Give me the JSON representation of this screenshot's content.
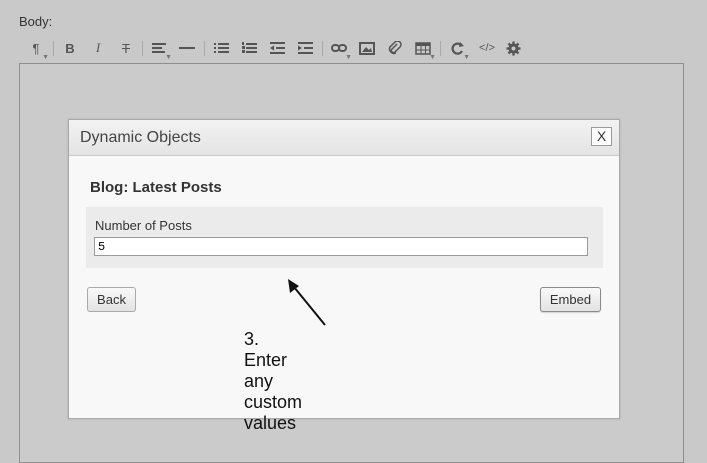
{
  "editor": {
    "body_label": "Body:"
  },
  "toolbar": {
    "paragraph": "¶",
    "bold": "B",
    "italic": "I",
    "strikethrough": "T",
    "source_code": "</>"
  },
  "dialog": {
    "title": "Dynamic Objects",
    "close_label": "X",
    "section_title": "Blog: Latest Posts",
    "field_label": "Number of Posts",
    "field_value": "5",
    "back_label": "Back",
    "embed_label": "Embed"
  },
  "annotation": {
    "text": "3. Enter any custom values"
  }
}
